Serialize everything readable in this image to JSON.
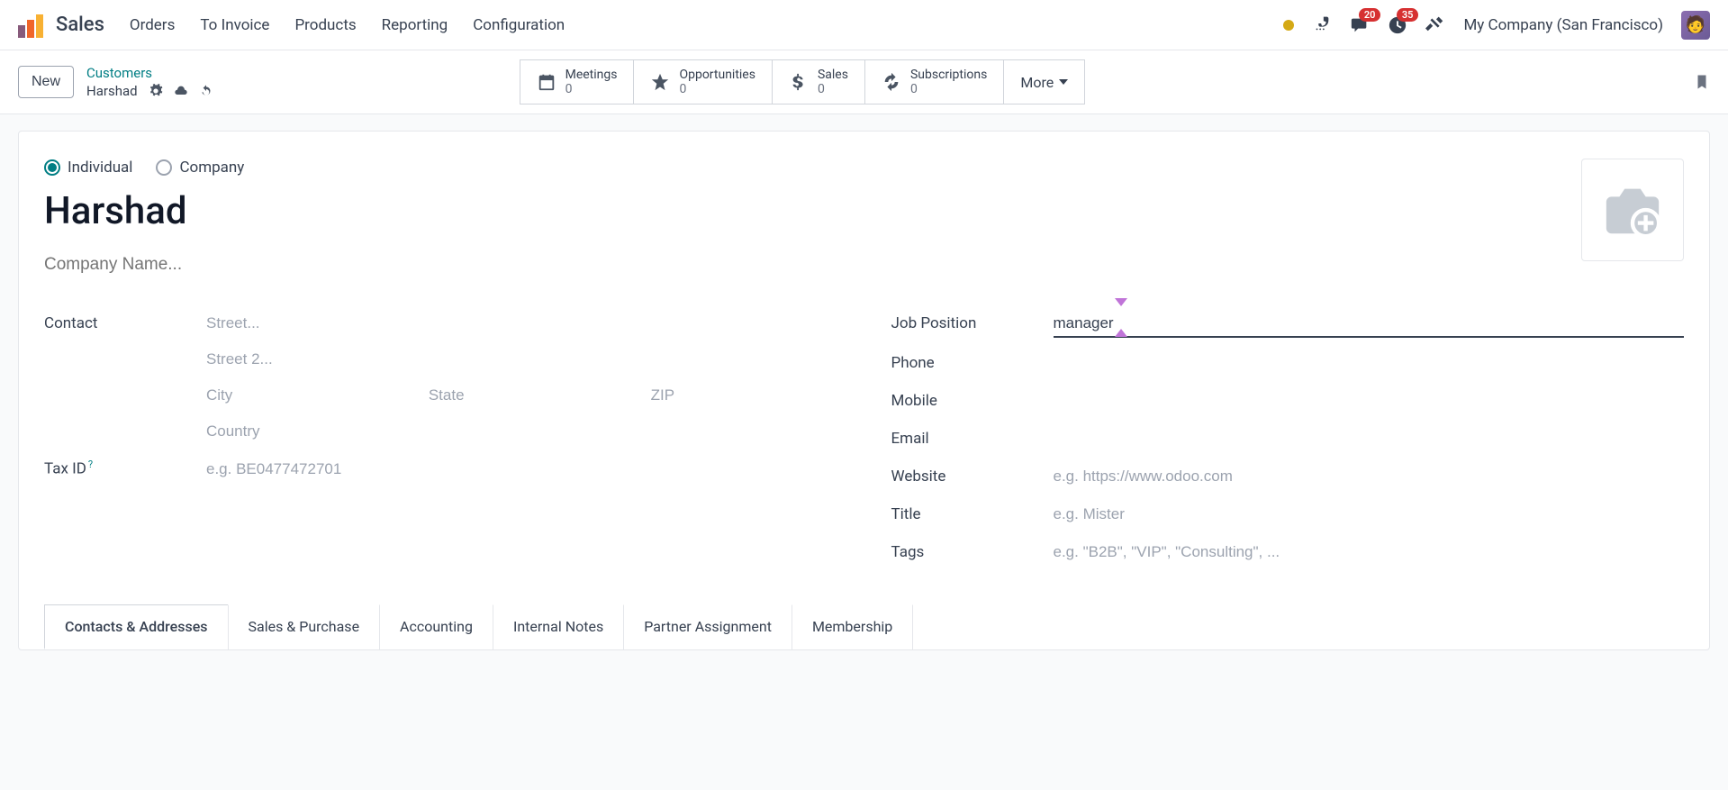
{
  "topbar": {
    "app_name": "Sales",
    "menu": [
      "Orders",
      "To Invoice",
      "Products",
      "Reporting",
      "Configuration"
    ],
    "chat_badge": "20",
    "activity_badge": "35",
    "company": "My Company (San Francisco)"
  },
  "secondbar": {
    "new_label": "New",
    "breadcrumb_parent": "Customers",
    "breadcrumb_current": "Harshad",
    "stats": {
      "meetings": {
        "label": "Meetings",
        "count": "0"
      },
      "opportunities": {
        "label": "Opportunities",
        "count": "0"
      },
      "sales": {
        "label": "Sales",
        "count": "0"
      },
      "subscriptions": {
        "label": "Subscriptions",
        "count": "0"
      }
    },
    "more_label": "More"
  },
  "form": {
    "radio_individual": "Individual",
    "radio_company": "Company",
    "record_name": "Harshad",
    "company_placeholder": "Company Name...",
    "contact_label": "Contact",
    "street_ph": "Street...",
    "street2_ph": "Street 2...",
    "city_ph": "City",
    "state_ph": "State",
    "zip_ph": "ZIP",
    "country_ph": "Country",
    "taxid_label": "Tax ID",
    "taxid_ph": "e.g. BE0477472701",
    "job_label": "Job Position",
    "job_value": "manager",
    "phone_label": "Phone",
    "mobile_label": "Mobile",
    "email_label": "Email",
    "website_label": "Website",
    "website_ph": "e.g. https://www.odoo.com",
    "title_label": "Title",
    "title_ph": "e.g. Mister",
    "tags_label": "Tags",
    "tags_ph": "e.g. \"B2B\", \"VIP\", \"Consulting\", ..."
  },
  "tabs": [
    "Contacts & Addresses",
    "Sales & Purchase",
    "Accounting",
    "Internal Notes",
    "Partner Assignment",
    "Membership"
  ]
}
